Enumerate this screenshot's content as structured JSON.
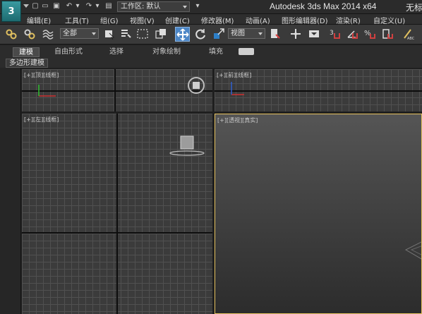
{
  "titlebar": {
    "logo_glyph": "3",
    "workspace_label": "工作区: 默认",
    "caption": "Autodesk 3ds Max  2014 x64",
    "document": "无标"
  },
  "menubar": {
    "items": [
      "编辑(E)",
      "工具(T)",
      "组(G)",
      "视图(V)",
      "创建(C)",
      "修改器(M)",
      "动画(A)",
      "图形编辑器(D)",
      "渲染(R)",
      "自定义(U)"
    ]
  },
  "toolbar": {
    "selection_filter": "全部",
    "reference_coord": "视图"
  },
  "ribbon": {
    "tabs": [
      "建模",
      "自由形式",
      "选择",
      "对象绘制",
      "填充"
    ],
    "panel_label": "多边形建模"
  },
  "viewports": {
    "top_left_label": "[+][顶][线框]",
    "top_right_label": "[+][前][线框]",
    "bottom_left_label": "[+][左][线框]",
    "perspective_label": "[+][透视][真实]"
  },
  "colors": {
    "active_tool": "#4c86c6",
    "active_viewport_border": "#e8c460",
    "grid_line": "#505050"
  }
}
